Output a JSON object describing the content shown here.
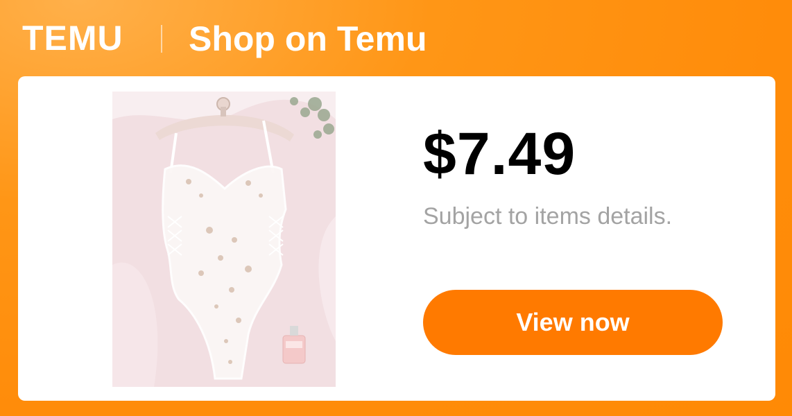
{
  "header": {
    "brand": "TEMU",
    "title": "Shop on Temu"
  },
  "product": {
    "image_icon": "product-photo",
    "price": "$7.49",
    "subtext": "Subject to items details.",
    "cta_label": "View now"
  },
  "colors": {
    "accent": "#ff7a00",
    "header_bg": "#ff8a00",
    "subtext": "#a3a3a3"
  }
}
